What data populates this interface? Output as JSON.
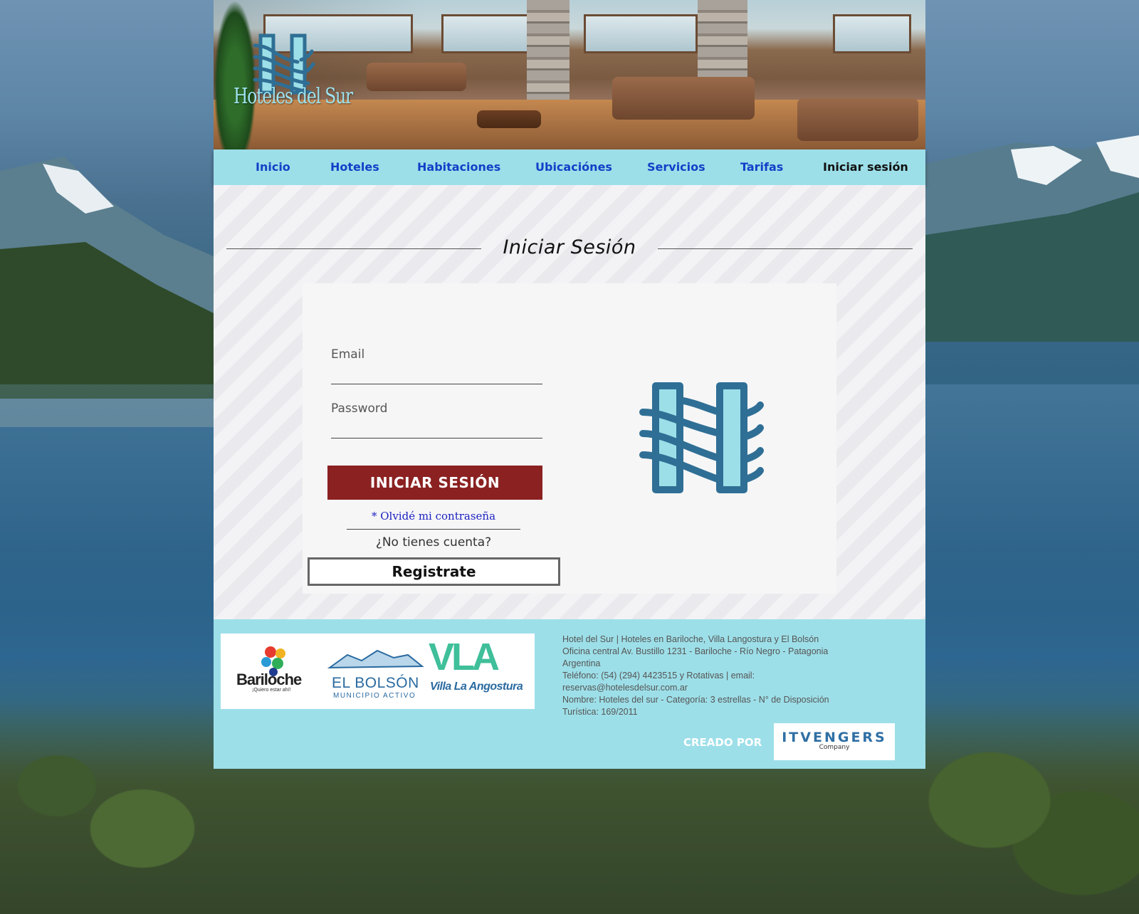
{
  "brand": {
    "name": "Hoteles del Sur"
  },
  "nav": {
    "items": [
      {
        "label": "Inicio"
      },
      {
        "label": "Hoteles"
      },
      {
        "label": "Habitaciones"
      },
      {
        "label": "Ubicaciónes"
      },
      {
        "label": "Servicios"
      },
      {
        "label": "Tarifas"
      },
      {
        "label": "Iniciar sesión",
        "active": true
      }
    ]
  },
  "login": {
    "title": "Iniciar Sesión",
    "email_label": "Email",
    "password_label": "Password",
    "submit_label": "INICIAR SESIÓN",
    "forgot_label": "* Olvidé mi contraseña",
    "no_account_label": "¿No tienes cuenta?",
    "register_label": "Registrate"
  },
  "footer": {
    "partners": [
      {
        "name": "Bariloche",
        "tagline": "¡Quiero estar ahí!"
      },
      {
        "name": "EL BOLSÓN",
        "tagline": "MUNICIPIO ACTIVO"
      },
      {
        "name": "VLA",
        "tagline": "Villa La Angostura"
      }
    ],
    "info_lines": [
      "Hotel del Sur | Hoteles en Bariloche, Villa Langostura y El Bolsón",
      "Oficina central Av. Bustillo 1231 - Bariloche - Río Negro - Patagonia",
      "Argentina",
      "Teléfono: (54) (294) 4423515 y Rotativas | email:",
      "reservas@hotelesdelsur.com.ar",
      "Nombre: Hoteles del sur - Categoría: 3 estrellas - N° de Disposición",
      "Turística: 169/2011"
    ],
    "created_by_label": "CREADO POR",
    "creator_name": "ITVENGERS",
    "creator_sub": "Company"
  },
  "colors": {
    "nav_bg": "#9ddfe8",
    "nav_link": "#1240c8",
    "submit_bg": "#8b2121",
    "logo_primary": "#2f6f95",
    "logo_fill": "#9ddfe8"
  }
}
